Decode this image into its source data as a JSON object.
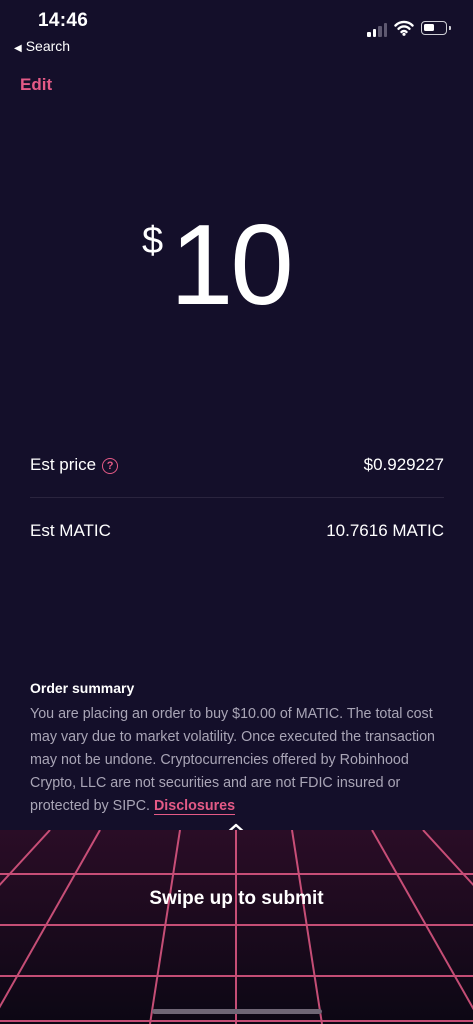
{
  "status_bar": {
    "time": "14:46",
    "back_label": "Search"
  },
  "header": {
    "edit_label": "Edit"
  },
  "order": {
    "currency_symbol": "$",
    "amount": "10"
  },
  "details": [
    {
      "label": "Est price",
      "value": "$0.929227"
    },
    {
      "label": "Est MATIC",
      "value": "10.7616 MATIC"
    }
  ],
  "summary": {
    "title": "Order summary",
    "body": "You are placing an order to buy $10.00 of MATIC. The total cost may vary due to market volatility. Once executed the transaction may not be undone. Cryptocurrencies offered by Robinhood Crypto, LLC are not securities and are not FDIC insured or protected by SIPC.",
    "link": "Disclosures"
  },
  "submit": {
    "label": "Swipe up to submit"
  },
  "colors": {
    "accent": "#e45a86",
    "card": "#140f2a",
    "background": "#0c0714",
    "grid": "#e45a86"
  },
  "icons": [
    "back-triangle-icon",
    "cellular-signal-icon",
    "wifi-icon",
    "battery-icon",
    "help-icon",
    "chevron-up-icon"
  ]
}
